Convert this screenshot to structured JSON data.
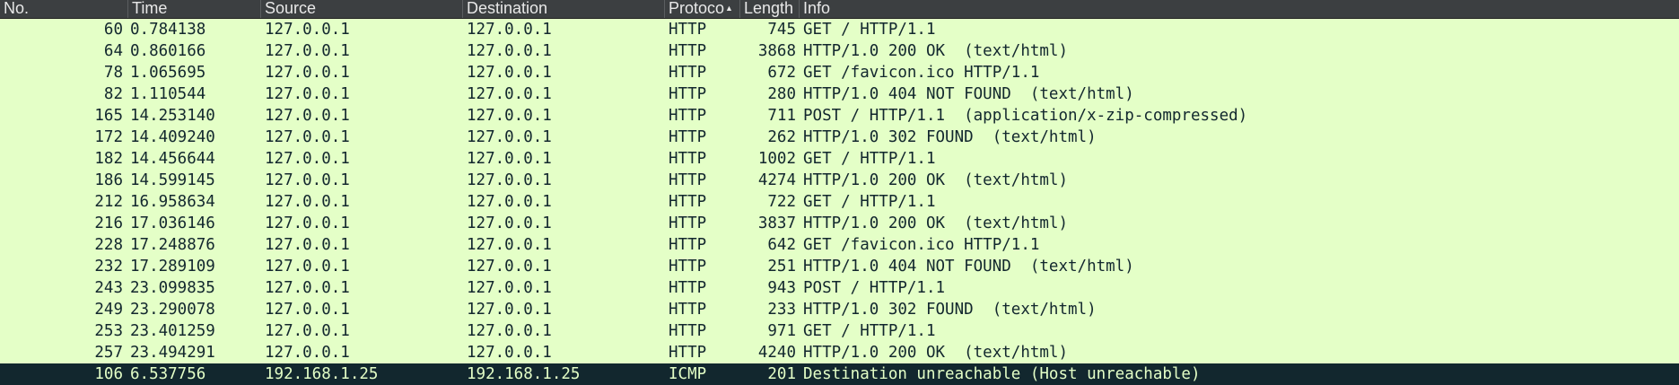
{
  "columns": [
    "No.",
    "Time",
    "Source",
    "Destination",
    "Protoco",
    "Length",
    "Info"
  ],
  "sort_indicator": "▲",
  "colors": {
    "header_bg": "#3c3f41",
    "http_row_bg": "#e4ffc7",
    "http_row_text": "#12272e",
    "icmp_row_bg": "#12272e",
    "icmp_row_text": "#e4ffc7"
  },
  "packets": [
    {
      "no": "60",
      "time": "0.784138",
      "source": "127.0.0.1",
      "destination": "127.0.0.1",
      "protocol": "HTTP",
      "length": "745",
      "info": "GET / HTTP/1.1"
    },
    {
      "no": "64",
      "time": "0.860166",
      "source": "127.0.0.1",
      "destination": "127.0.0.1",
      "protocol": "HTTP",
      "length": "3868",
      "info": "HTTP/1.0 200 OK  (text/html)"
    },
    {
      "no": "78",
      "time": "1.065695",
      "source": "127.0.0.1",
      "destination": "127.0.0.1",
      "protocol": "HTTP",
      "length": "672",
      "info": "GET /favicon.ico HTTP/1.1"
    },
    {
      "no": "82",
      "time": "1.110544",
      "source": "127.0.0.1",
      "destination": "127.0.0.1",
      "protocol": "HTTP",
      "length": "280",
      "info": "HTTP/1.0 404 NOT FOUND  (text/html)"
    },
    {
      "no": "165",
      "time": "14.253140",
      "source": "127.0.0.1",
      "destination": "127.0.0.1",
      "protocol": "HTTP",
      "length": "711",
      "info": "POST / HTTP/1.1  (application/x-zip-compressed)"
    },
    {
      "no": "172",
      "time": "14.409240",
      "source": "127.0.0.1",
      "destination": "127.0.0.1",
      "protocol": "HTTP",
      "length": "262",
      "info": "HTTP/1.0 302 FOUND  (text/html)"
    },
    {
      "no": "182",
      "time": "14.456644",
      "source": "127.0.0.1",
      "destination": "127.0.0.1",
      "protocol": "HTTP",
      "length": "1002",
      "info": "GET / HTTP/1.1"
    },
    {
      "no": "186",
      "time": "14.599145",
      "source": "127.0.0.1",
      "destination": "127.0.0.1",
      "protocol": "HTTP",
      "length": "4274",
      "info": "HTTP/1.0 200 OK  (text/html)"
    },
    {
      "no": "212",
      "time": "16.958634",
      "source": "127.0.0.1",
      "destination": "127.0.0.1",
      "protocol": "HTTP",
      "length": "722",
      "info": "GET / HTTP/1.1"
    },
    {
      "no": "216",
      "time": "17.036146",
      "source": "127.0.0.1",
      "destination": "127.0.0.1",
      "protocol": "HTTP",
      "length": "3837",
      "info": "HTTP/1.0 200 OK  (text/html)"
    },
    {
      "no": "228",
      "time": "17.248876",
      "source": "127.0.0.1",
      "destination": "127.0.0.1",
      "protocol": "HTTP",
      "length": "642",
      "info": "GET /favicon.ico HTTP/1.1"
    },
    {
      "no": "232",
      "time": "17.289109",
      "source": "127.0.0.1",
      "destination": "127.0.0.1",
      "protocol": "HTTP",
      "length": "251",
      "info": "HTTP/1.0 404 NOT FOUND  (text/html)"
    },
    {
      "no": "243",
      "time": "23.099835",
      "source": "127.0.0.1",
      "destination": "127.0.0.1",
      "protocol": "HTTP",
      "length": "943",
      "info": "POST / HTTP/1.1"
    },
    {
      "no": "249",
      "time": "23.290078",
      "source": "127.0.0.1",
      "destination": "127.0.0.1",
      "protocol": "HTTP",
      "length": "233",
      "info": "HTTP/1.0 302 FOUND  (text/html)"
    },
    {
      "no": "253",
      "time": "23.401259",
      "source": "127.0.0.1",
      "destination": "127.0.0.1",
      "protocol": "HTTP",
      "length": "971",
      "info": "GET / HTTP/1.1"
    },
    {
      "no": "257",
      "time": "23.494291",
      "source": "127.0.0.1",
      "destination": "127.0.0.1",
      "protocol": "HTTP",
      "length": "4240",
      "info": "HTTP/1.0 200 OK  (text/html)"
    },
    {
      "no": "106",
      "time": "6.537756",
      "source": "192.168.1.25",
      "destination": "192.168.1.25",
      "protocol": "ICMP",
      "length": "201",
      "info": "Destination unreachable (Host unreachable)"
    }
  ]
}
